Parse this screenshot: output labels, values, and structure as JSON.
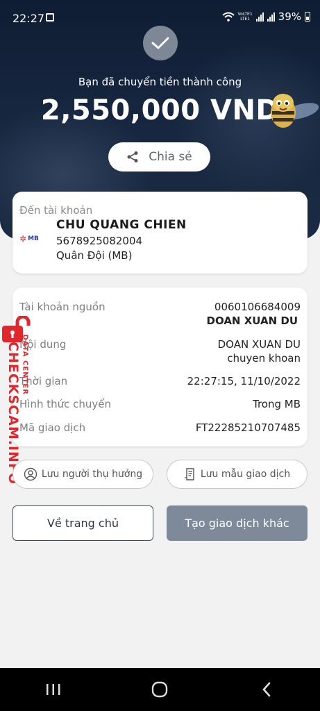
{
  "status_bar": {
    "time": "22:27",
    "network": "VoLTE1",
    "network_sub": "LTE1",
    "battery": "39%"
  },
  "hero": {
    "success_message": "Bạn đã chuyển tiền thành công",
    "amount": "2,550,000 VND",
    "share_label": "Chia sẻ"
  },
  "destination": {
    "label": "Đến tài khoản",
    "bank_logo": "MB",
    "name": "CHU QUANG CHIEN",
    "account_number": "5678925082004",
    "bank_name": "Quân Đội (MB)"
  },
  "details": {
    "source_label": "Tài khoản nguồn",
    "source_account": "0060106684009",
    "source_name": "DOAN XUAN DU",
    "content_label": "Nội dung",
    "content_line1": "DOAN XUAN DU",
    "content_line2": "chuyen khoan",
    "time_label": "Thời gian",
    "time_value": "22:27:15, 11/10/2022",
    "method_label": "Hình thức chuyển",
    "method_value": "Trong MB",
    "txn_label": "Mã giao dịch",
    "txn_value": "FT22285210707485"
  },
  "actions": {
    "save_recipient": "Lưu người thụ hưởng",
    "save_template": "Lưu mẫu giao dịch",
    "home": "Về trang chủ",
    "new_transaction": "Tạo giao dịch khác"
  },
  "watermark": {
    "main": "CHECKSCAM.INFO",
    "sub": "DATA CENTER"
  },
  "colors": {
    "hero_bg": "#16263f",
    "primary_button": "#7e8a9a",
    "watermark": "#e1262c",
    "bank_blue": "#2f3d9a"
  }
}
